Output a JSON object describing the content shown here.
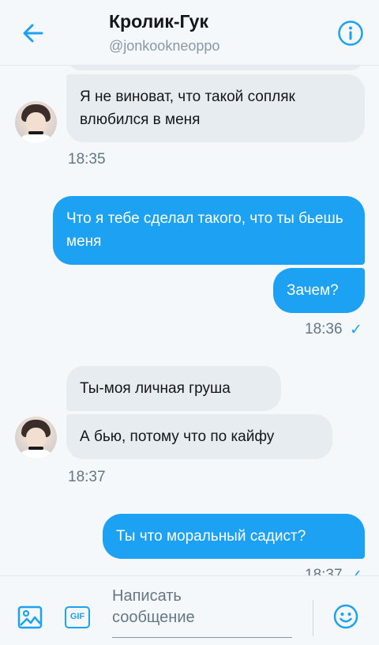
{
  "header": {
    "title": "Кролик-Гук",
    "handle": "@jonkookneoppo"
  },
  "messages": [
    {
      "direction": "in",
      "text": "Я не виноват, что такой сопляк влюбился в меня"
    },
    {
      "direction": "out",
      "text": "Что я тебе сделал такого, что ты бьешь меня"
    },
    {
      "direction": "out",
      "text": "Зачем?"
    },
    {
      "direction": "in",
      "text": "Ты-моя личная груша"
    },
    {
      "direction": "in",
      "text": "А бью, потому что по кайфу"
    },
    {
      "direction": "out",
      "text": "Ты что моральный садист?"
    }
  ],
  "timestamps": [
    "18:35",
    "18:36",
    "18:37",
    "18:37"
  ],
  "read_mark": "✓",
  "composer": {
    "placeholder": "Написать\nсообщение",
    "gif_label": "GIF"
  },
  "icons": [
    "back-arrow-icon",
    "info-icon",
    "image-icon",
    "gif-icon",
    "emoji-icon"
  ],
  "colors": {
    "accent": "#1da1f2",
    "incoming_bubble": "#e6ecf0",
    "background": "#f5f8fa",
    "timestamp": "#657786"
  }
}
